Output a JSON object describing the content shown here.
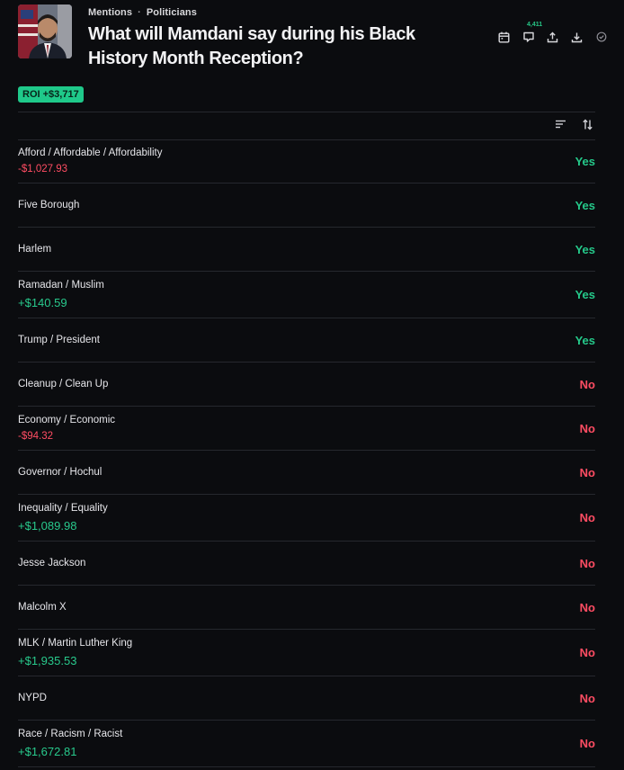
{
  "header": {
    "breadcrumb": [
      "Mentions",
      "Politicians"
    ],
    "separator": "·",
    "title": "What will Mamdani say during his Black History Month Reception?",
    "comment_count": "4,411"
  },
  "roi": "ROI +$3,717",
  "colors": {
    "background": "#0b0c0f",
    "yes": "#25c98a",
    "no": "#ff4d63",
    "gain": "#28c98c",
    "loss": "#ff4d63",
    "roi_badge": "#1fc98a"
  },
  "markets": [
    {
      "label": "Afford / Affordable / Affordability",
      "pnl": "-$1,027.93",
      "pnl_sign": "neg",
      "result": "Yes"
    },
    {
      "label": "Five Borough",
      "pnl": "",
      "pnl_sign": "",
      "result": "Yes"
    },
    {
      "label": "Harlem",
      "pnl": "",
      "pnl_sign": "",
      "result": "Yes"
    },
    {
      "label": "Ramadan / Muslim",
      "pnl": "+$140.59",
      "pnl_sign": "pos",
      "result": "Yes"
    },
    {
      "label": "Trump / President",
      "pnl": "",
      "pnl_sign": "",
      "result": "Yes"
    },
    {
      "label": "Cleanup / Clean Up",
      "pnl": "",
      "pnl_sign": "",
      "result": "No"
    },
    {
      "label": "Economy / Economic",
      "pnl": "-$94.32",
      "pnl_sign": "neg",
      "result": "No"
    },
    {
      "label": "Governor / Hochul",
      "pnl": "",
      "pnl_sign": "",
      "result": "No"
    },
    {
      "label": "Inequality / Equality",
      "pnl": "+$1,089.98",
      "pnl_sign": "pos",
      "result": "No"
    },
    {
      "label": "Jesse Jackson",
      "pnl": "",
      "pnl_sign": "",
      "result": "No"
    },
    {
      "label": "Malcolm X",
      "pnl": "",
      "pnl_sign": "",
      "result": "No"
    },
    {
      "label": "MLK / Martin Luther King",
      "pnl": "+$1,935.53",
      "pnl_sign": "pos",
      "result": "No"
    },
    {
      "label": "NYPD",
      "pnl": "",
      "pnl_sign": "",
      "result": "No"
    },
    {
      "label": "Race / Racism / Racist",
      "pnl": "+$1,672.81",
      "pnl_sign": "pos",
      "result": "No"
    }
  ]
}
